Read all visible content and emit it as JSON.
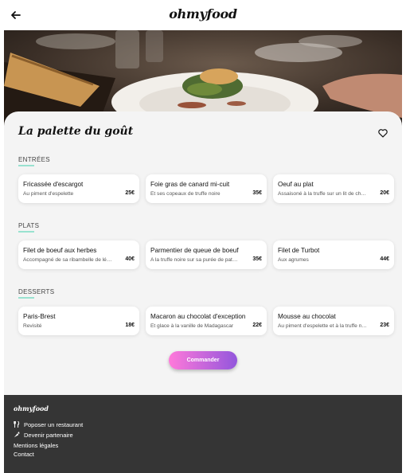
{
  "header": {
    "brand": "ohmyfood",
    "back_icon": "arrow-left-icon"
  },
  "restaurant": {
    "name": "La palette du goût",
    "favorite_icon": "heart-outline-icon"
  },
  "menu": [
    {
      "title": "ENTRÉES",
      "dishes": [
        {
          "name": "Fricassée d'escargot",
          "description": "Au piment d'espelette",
          "price": "25€"
        },
        {
          "name": "Foie gras de canard mi-cuit",
          "description": "Et ses copeaux de truffe noire",
          "price": "35€"
        },
        {
          "name": "Oeuf au plat",
          "description": "Assaisoné à la truffe sur un lit de champignons",
          "price": "20€"
        }
      ]
    },
    {
      "title": "PLATS",
      "dishes": [
        {
          "name": "Filet de boeuf aux herbes",
          "description": "Accompagné de sa ribambelle de légumes",
          "price": "40€"
        },
        {
          "name": "Parmentier de queue de boeuf",
          "description": "A la truffe noire sur sa purée de patates",
          "price": "35€"
        },
        {
          "name": "Filet de Turbot",
          "description": "Aux agrumes",
          "price": "44€"
        }
      ]
    },
    {
      "title": "DESSERTS",
      "dishes": [
        {
          "name": "Paris-Brest",
          "description": "Revisité",
          "price": "18€"
        },
        {
          "name": "Macaron au chocolat d'exception",
          "description": "Et glace à la vanille de Madagascar",
          "price": "22€"
        },
        {
          "name": "Mousse au chocolat",
          "description": "Au piment d'espelette et à la truffe noire",
          "price": "23€"
        }
      ]
    }
  ],
  "order_button": "Commander",
  "footer": {
    "brand": "ohmyfood",
    "links": [
      {
        "label": "Poposer un restaurant",
        "icon": "utensils-icon"
      },
      {
        "label": "Devenir partenaire",
        "icon": "carrot-icon"
      },
      {
        "label": "Mentions légales"
      },
      {
        "label": "Contact"
      }
    ]
  },
  "colors": {
    "accent_gradient_start": "#ff79da",
    "accent_gradient_end": "#9356dc",
    "section_underline": "#99e2d0",
    "footer_background": "#353535",
    "page_background": "#f4f4f4"
  }
}
